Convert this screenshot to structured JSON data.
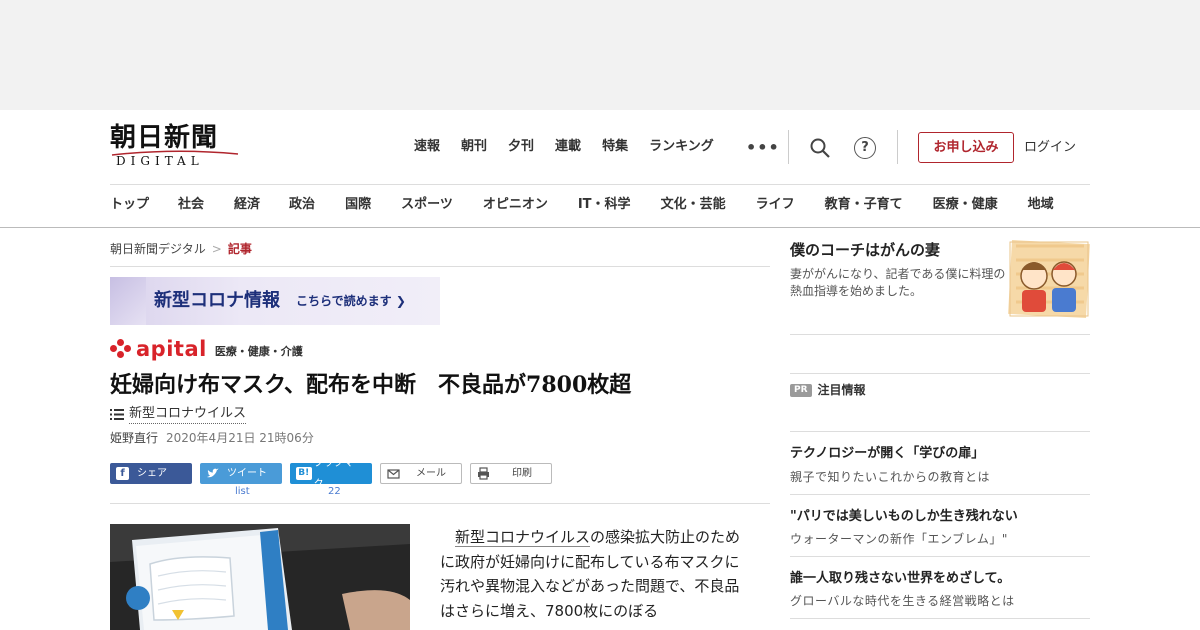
{
  "logo": {
    "main": "朝日新聞",
    "sub": "DIGITAL"
  },
  "top_nav": [
    "速報",
    "朝刊",
    "夕刊",
    "連載",
    "特集",
    "ランキング"
  ],
  "more_icon": "•••",
  "help_icon": "?",
  "apply_button": "お申し込み",
  "login_link": "ログイン",
  "categories": [
    "トップ",
    "社会",
    "経済",
    "政治",
    "国際",
    "スポーツ",
    "オピニオン",
    "IT・科学",
    "文化・芸能",
    "ライフ",
    "教育・子育て",
    "医療・健康",
    "地域"
  ],
  "breadcrumb": {
    "home": "朝日新聞デジタル",
    "separator": ">",
    "current": "記事"
  },
  "corona_banner": {
    "title": "新型コロナ情報",
    "link": "こちらで読めます ❯"
  },
  "apital": {
    "word": "apital",
    "sub": "医療・健康・介護"
  },
  "article": {
    "headline": "妊婦向け布マスク、配布を中断　不良品が7800枚超",
    "topic": "新型コロナウイルス",
    "author": "姫野直行",
    "date": "2020年4月21日 21時06分",
    "body_keyword": "新型コロナウイルス",
    "body_rest": "の感染拡大防止のために政府が妊婦向けに配布している布マスクに汚れや異物混入などがあった問題で、不良品はさらに増え、7800枚にのぼる"
  },
  "share": {
    "facebook": "シェア",
    "twitter": "ツイート",
    "twitter_count": "list",
    "hatena": "ブックマーク",
    "hatena_icon": "B!",
    "hatena_count": "22",
    "mail": "メール",
    "print": "印刷"
  },
  "sidebar": {
    "feature_title": "僕のコーチはがんの妻",
    "feature_desc": "妻ががんになり、記者である僕に料理の熱血指導を始めました。",
    "pr_badge": "PR",
    "pr_heading": "注目情報",
    "pr_items": [
      {
        "title": "テクノロジーが開く「学びの扉」",
        "sub": "親子で知りたいこれからの教育とは"
      },
      {
        "title": "\"パリでは美しいものしか生き残れない",
        "sub": "ウォーターマンの新作「エンブレム」\""
      },
      {
        "title": "誰一人取り残さない世界をめざして。",
        "sub": "グローバルな時代を生きる経営戦略とは"
      }
    ]
  },
  "colors": {
    "brand_red": "#b0252d",
    "apital_red": "#d8232a",
    "facebook": "#3b5998",
    "twitter": "#4a9bd8",
    "hatena": "#1f8fd6",
    "corona_navy": "#1d2f7a"
  },
  "icons": [
    "facebook-icon",
    "twitter-icon",
    "hatena-icon",
    "mail-icon",
    "print-icon",
    "search-icon",
    "help-icon",
    "list-icon",
    "more-icon"
  ]
}
